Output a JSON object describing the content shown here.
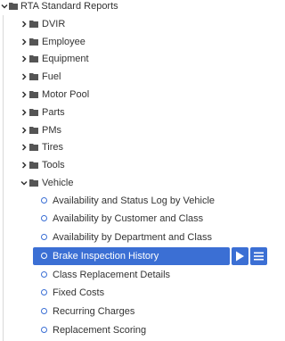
{
  "tree": {
    "root": {
      "label": "RTA Standard Reports",
      "icon": "folder-icon",
      "expanded": true
    },
    "folders": [
      {
        "label": "DVIR",
        "expanded": false
      },
      {
        "label": "Employee",
        "expanded": false
      },
      {
        "label": "Equipment",
        "expanded": false
      },
      {
        "label": "Fuel",
        "expanded": false
      },
      {
        "label": "Motor Pool",
        "expanded": false
      },
      {
        "label": "Parts",
        "expanded": false
      },
      {
        "label": "PMs",
        "expanded": false
      },
      {
        "label": "Tires",
        "expanded": false
      },
      {
        "label": "Tools",
        "expanded": false
      },
      {
        "label": "Vehicle",
        "expanded": true
      }
    ],
    "vehicle_reports": [
      {
        "label": "Availability and Status Log by Vehicle"
      },
      {
        "label": "Availability by Customer and Class"
      },
      {
        "label": "Availability by Department and Class"
      },
      {
        "label": "Brake Inspection History",
        "selected": true
      },
      {
        "label": "Class Replacement Details"
      },
      {
        "label": "Fixed Costs"
      },
      {
        "label": "Recurring Charges"
      },
      {
        "label": "Replacement Scoring"
      }
    ]
  },
  "actions": {
    "run_icon": "play-icon",
    "menu_icon": "hamburger-menu-icon"
  },
  "colors": {
    "accent": "#3b6fd4",
    "text": "#333333",
    "folder": "#555555"
  }
}
